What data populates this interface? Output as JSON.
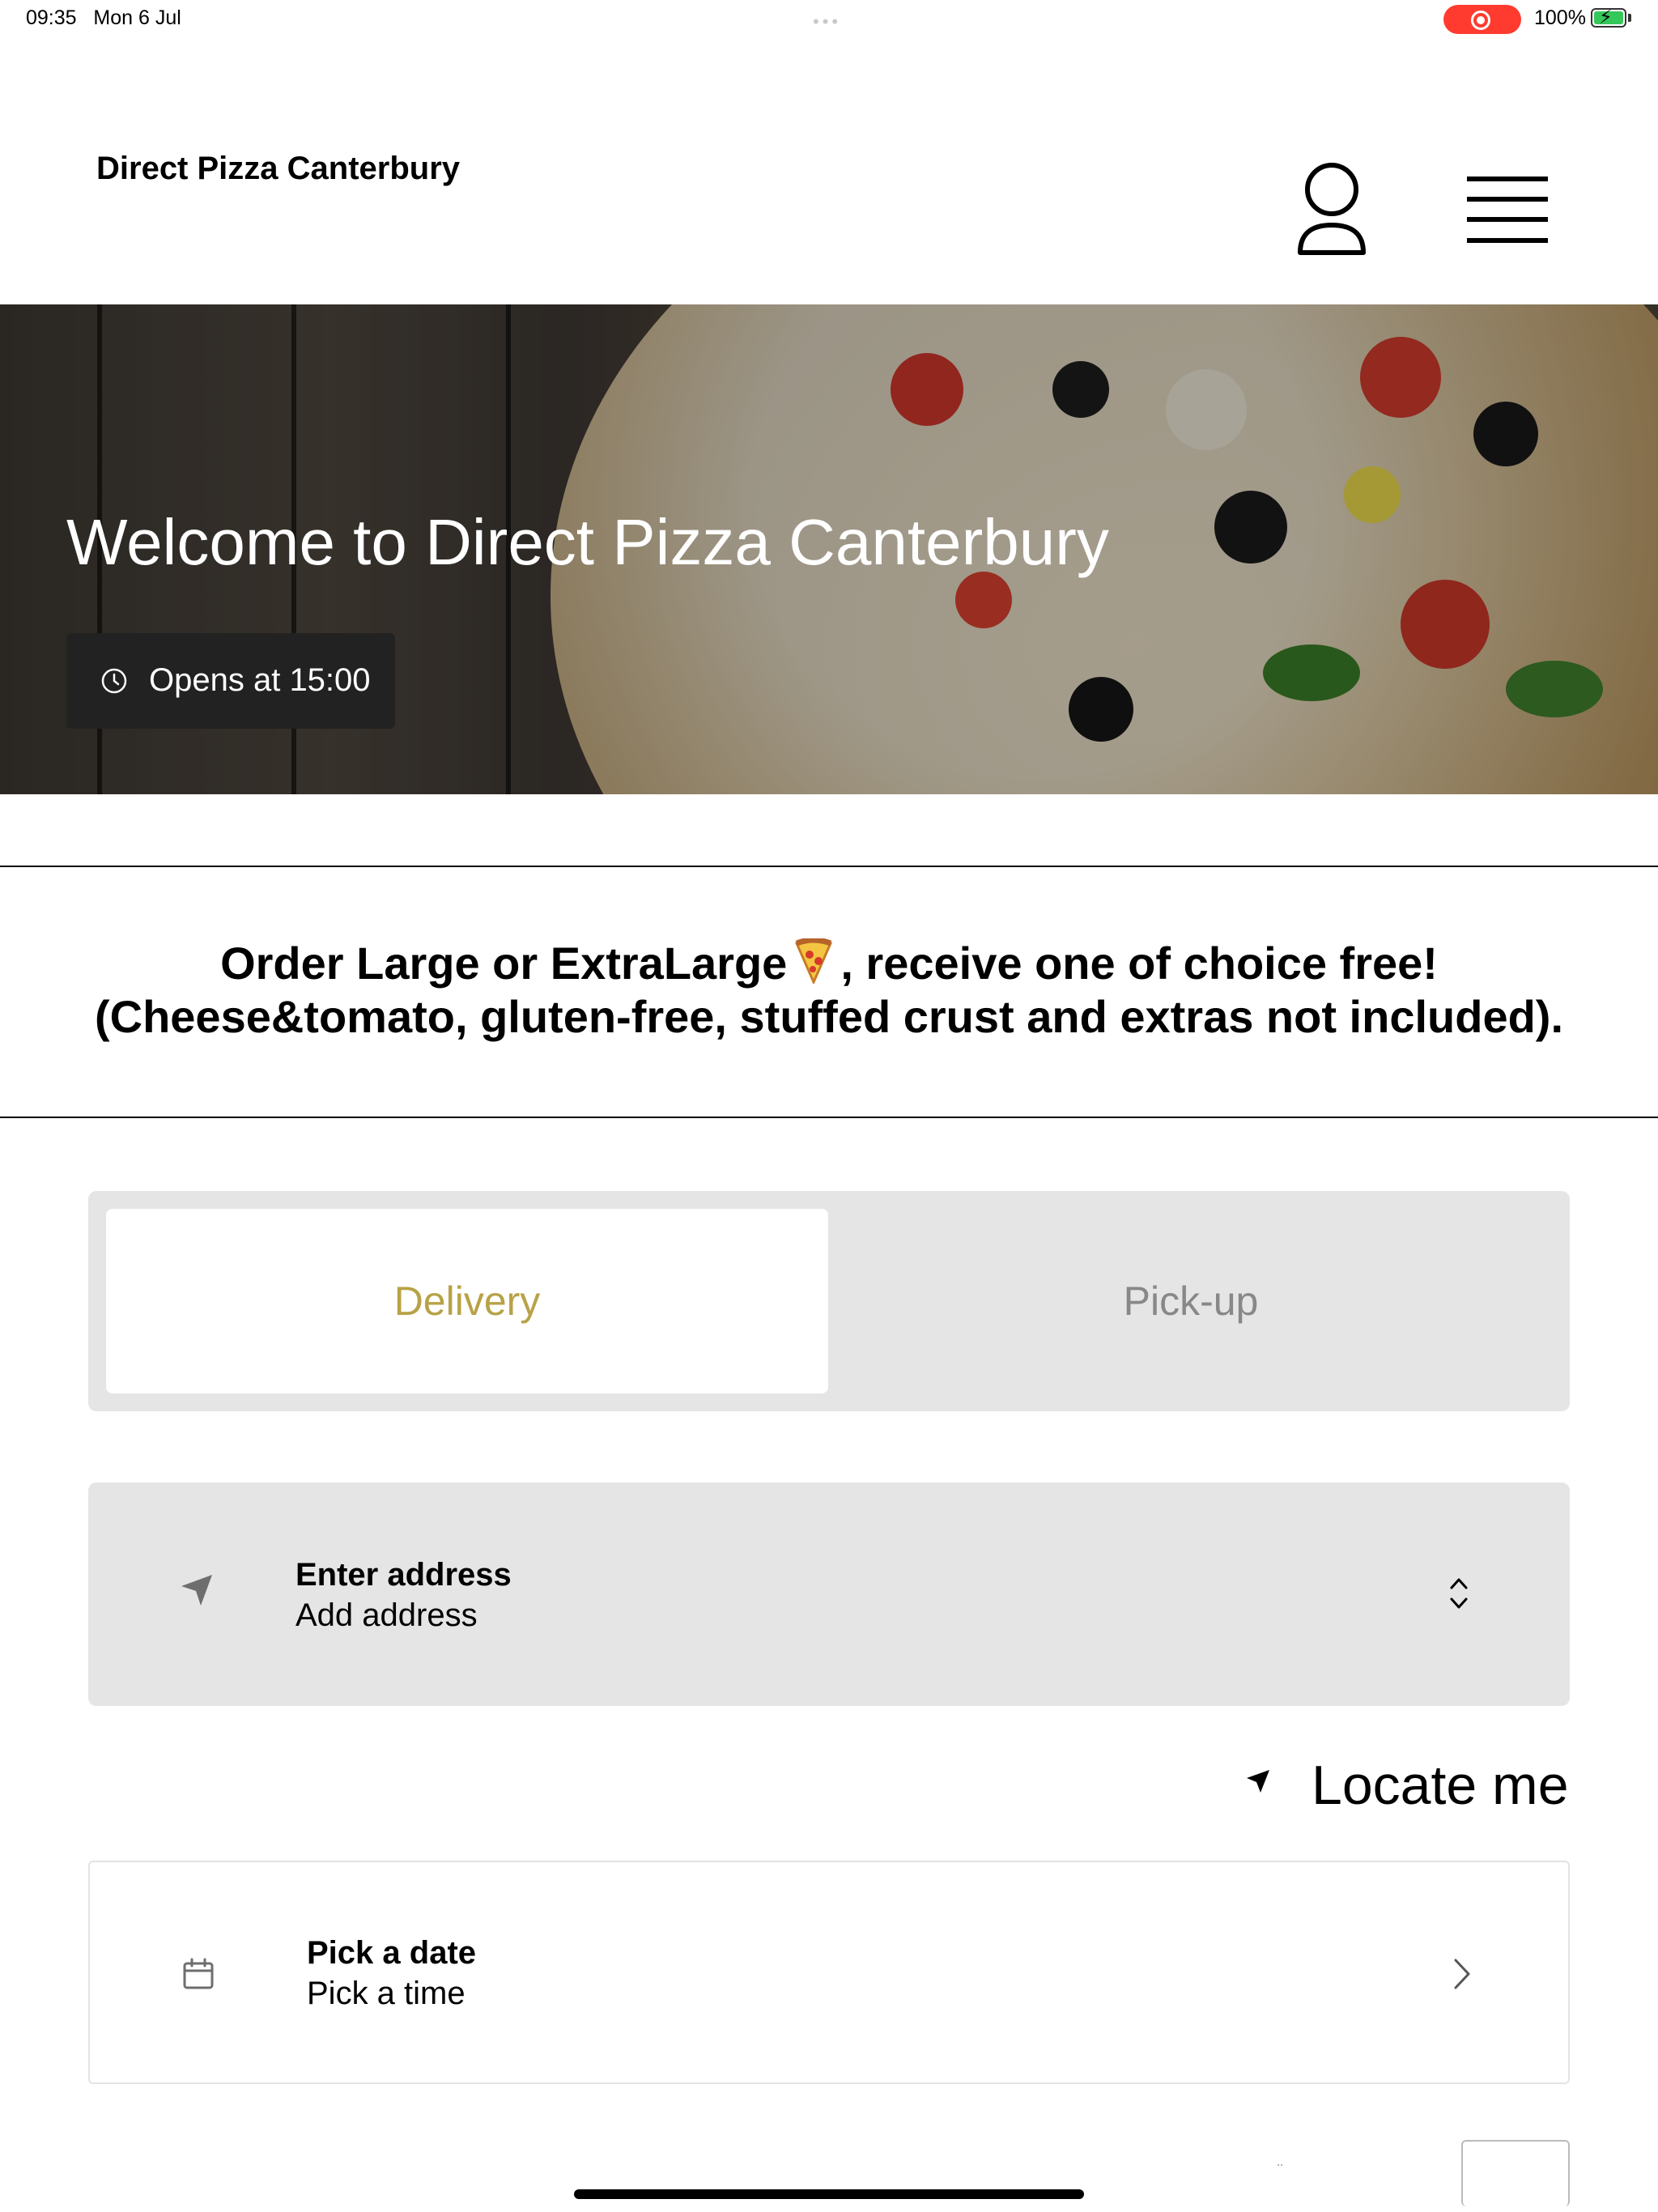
{
  "status_bar": {
    "time": "09:35",
    "date": "Mon 6 Jul",
    "battery": "100%",
    "recording_color": "#ff3b30",
    "battery_color": "#34c759"
  },
  "header": {
    "brand": "Direct Pizza Canterbury",
    "icons": [
      "user-icon",
      "menu-icon"
    ]
  },
  "hero": {
    "title": "Welcome to Direct Pizza Canterbury",
    "opens_text": "Opens at 15:00",
    "icon": "clock-icon"
  },
  "promo": {
    "line1_a": "Order Large or ExtraLarge",
    "line1_b": ", receive one of choice free!",
    "line2": "(Cheese&tomato, gluten-free, stuffed crust and extras not included).",
    "icon": "pizza-emoji"
  },
  "order_mode": {
    "tabs": [
      {
        "label": "Delivery",
        "selected": true
      },
      {
        "label": "Pick-up",
        "selected": false
      }
    ],
    "accent_color": "#b8a247"
  },
  "address": {
    "title": "Enter address",
    "subtitle": "Add address"
  },
  "locate": {
    "label": "Locate me"
  },
  "schedule": {
    "title": "Pick a date",
    "subtitle": "Pick a time"
  }
}
